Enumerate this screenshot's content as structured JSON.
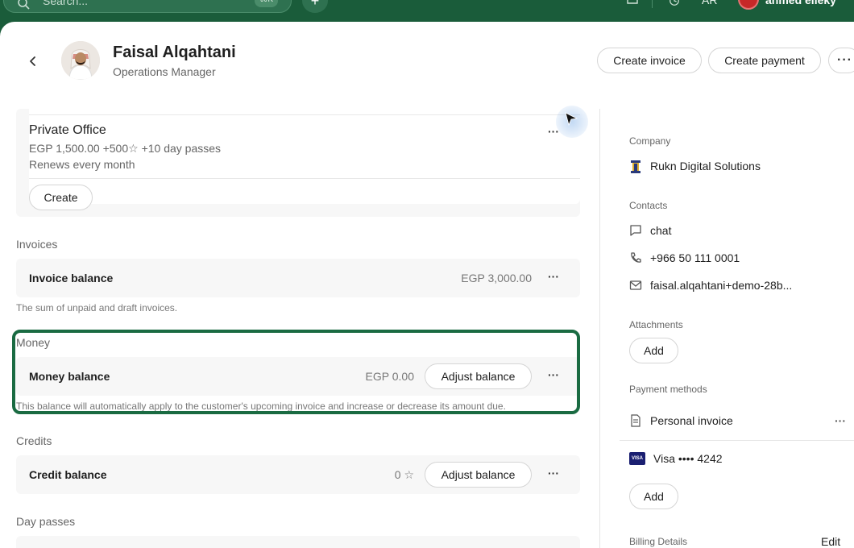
{
  "topbar": {
    "search_placeholder": "Search...",
    "search_kbd": "⌘K",
    "plus_label": "+",
    "lang": "AR",
    "user_name": "ahmed elleky"
  },
  "profile": {
    "name": "Faisal Alqahtani",
    "role": "Operations Manager"
  },
  "actions": {
    "create_invoice": "Create invoice",
    "create_payment": "Create payment",
    "more": "···"
  },
  "plan": {
    "title": "Private Office",
    "details": "EGP 1,500.00 +500☆ +10 day passes",
    "renewal": "Renews every month",
    "create_label": "Create",
    "more": "···"
  },
  "invoices": {
    "section": "Invoices",
    "title": "Invoice balance",
    "value": "EGP 3,000.00",
    "helper": "The sum of unpaid and draft invoices.",
    "more": "···"
  },
  "money": {
    "section": "Money",
    "title": "Money balance",
    "value": "EGP 0.00",
    "adjust_label": "Adjust balance",
    "helper": "This balance will automatically apply to the customer's upcoming invoice and increase or decrease its amount due.",
    "more": "···"
  },
  "credits": {
    "section": "Credits",
    "title": "Credit balance",
    "value": "0 ☆",
    "adjust_label": "Adjust balance",
    "more": "···"
  },
  "day_passes": {
    "section": "Day passes"
  },
  "sidebar": {
    "company_label": "Company",
    "company_name": "Rukn Digital Solutions",
    "contacts_label": "Contacts",
    "contact_chat": "chat",
    "contact_phone": "+966 50 111 0001",
    "contact_email": "faisal.alqahtani+demo-28b...",
    "attachments_label": "Attachments",
    "attachments_add": "Add",
    "payment_label": "Payment methods",
    "payment_invoice": "Personal invoice",
    "payment_card": "Visa •••• 4242",
    "payment_card_brand": "VISA",
    "payment_add": "Add",
    "payment_more": "···",
    "billing_label": "Billing Details",
    "billing_edit": "Edit"
  },
  "colors": {
    "brand": "#1a5c3a",
    "highlight": "#1a6b42"
  }
}
